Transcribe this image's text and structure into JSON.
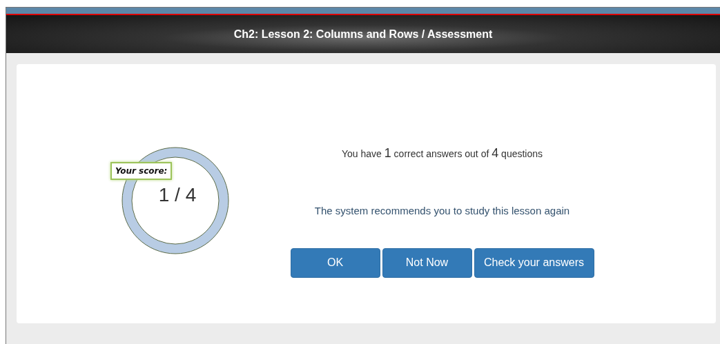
{
  "header": {
    "title": "Ch2: Lesson 2: Columns and Rows / Assessment"
  },
  "score": {
    "label": "Your score:",
    "value": "1 / 4"
  },
  "result": [
    {
      "text": "You have ",
      "large": false
    },
    {
      "text": "1",
      "large": true
    },
    {
      "text": " correct answers out of ",
      "large": false
    },
    {
      "text": "4",
      "large": true
    },
    {
      "text": " questions",
      "large": false
    }
  ],
  "recommendation": "The system recommends you to study this lesson again",
  "buttons": [
    "OK",
    "Not Now",
    "Check your answers"
  ]
}
